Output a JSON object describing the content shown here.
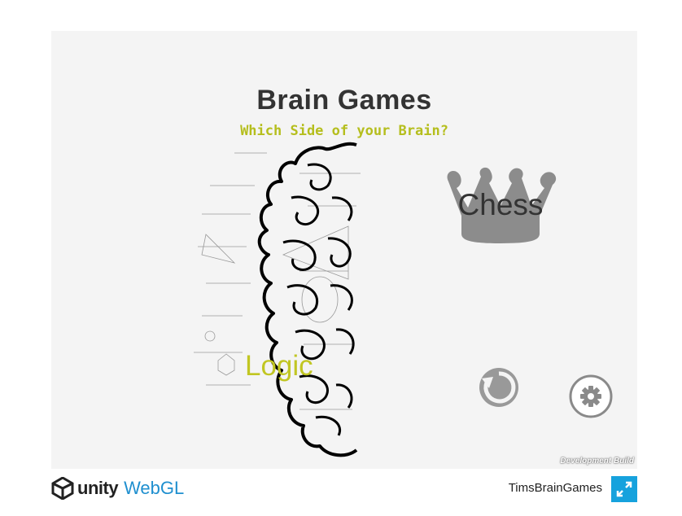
{
  "game": {
    "title": "Brain Games",
    "subtitle": "Which Side of your Brain?",
    "left_label": "Logic",
    "right_label": "Chess",
    "restart_icon": "restart-icon",
    "settings_icon": "gear-icon",
    "dev_build": "Development Build"
  },
  "footer": {
    "unity_text": "unity",
    "webgl_text": "WebGL",
    "product_name": "TimsBrainGames",
    "fullscreen_icon": "fullscreen-icon"
  },
  "colors": {
    "canvas_bg": "#f4f4f4",
    "title": "#333333",
    "accent_yellow": "#b5be1d",
    "crown_gray": "#8c8c8c",
    "unity_blue": "#1f8fcf",
    "fullscreen_blue": "#16a2dd"
  }
}
